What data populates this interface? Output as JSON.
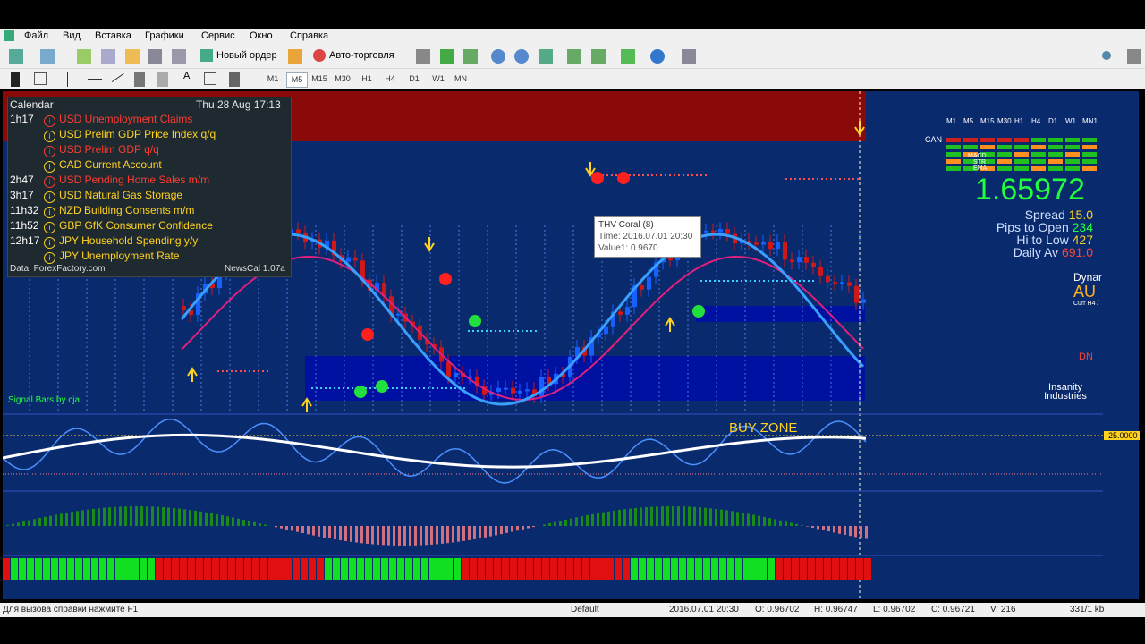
{
  "menu": [
    "Файл",
    "Вид",
    "Вставка",
    "Графики",
    "Сервис",
    "Окно",
    "Справка"
  ],
  "toolbar": {
    "new_order": "Новый ордер",
    "auto_trade": "Авто-торговля"
  },
  "timeframes": [
    "M1",
    "M5",
    "M15",
    "M30",
    "H1",
    "H4",
    "D1",
    "W1",
    "MN"
  ],
  "selected_tf": "M5",
  "calendar": {
    "title": "Calendar",
    "date": "Thu 28 Aug 17:13",
    "rows": [
      {
        "time": "1h17",
        "text": "USD Unemployment Claims",
        "color": "red"
      },
      {
        "time": "",
        "text": "USD Prelim GDP Price Index q/q",
        "color": "yel"
      },
      {
        "time": "",
        "text": "USD Prelim GDP q/q",
        "color": "red"
      },
      {
        "time": "",
        "text": "CAD Current Account",
        "color": "yel"
      },
      {
        "time": "2h47",
        "text": "USD Pending Home Sales m/m",
        "color": "red"
      },
      {
        "time": "3h17",
        "text": "USD Natural Gas Storage",
        "color": "yel"
      },
      {
        "time": "11h32",
        "text": "NZD Building Consents m/m",
        "color": "yel"
      },
      {
        "time": "11h52",
        "text": "GBP GfK Consumer Confidence",
        "color": "yel"
      },
      {
        "time": "12h17",
        "text": "JPY Household Spending y/y",
        "color": "yel"
      },
      {
        "time": "",
        "text": "JPY Unemployment Rate",
        "color": "yel"
      }
    ],
    "source": "Data: ForexFactory.com",
    "version": "NewsCal 1.07a"
  },
  "tooltip": {
    "name": "THV Coral (8)",
    "time": "Time: 2016.07.01 20:30",
    "value": "Value1: 0.9670"
  },
  "signal_label": "Signal Bars by cja",
  "buy_zone": "BUY ZONE",
  "osc_level": "-25.0000",
  "panel": {
    "tf_header": [
      "M1",
      "M5",
      "M15",
      "M30",
      "H1",
      "H4",
      "D1",
      "W1",
      "MN1"
    ],
    "can": "CAN",
    "rows": [
      "MACD",
      "STR",
      "EMA"
    ],
    "price": "1.65972",
    "spread_label": "Spread",
    "spread": "15.0",
    "pips_label": "Pips to Open",
    "pips": "234",
    "hilo_label": "Hi to Low",
    "hilo": "427",
    "daily_label": "Daily Av",
    "daily": "691.0",
    "dyn": "Dynar",
    "sym": "AU",
    "curr": "Curr H4 /",
    "dn": "DN",
    "brand": "Insanity Industries"
  },
  "status": {
    "help": "Для вызова справки нажмите F1",
    "profile": "Default",
    "datetime": "2016.07.01 20:30",
    "open": "O: 0.96702",
    "high": "H: 0.96747",
    "low": "L: 0.96702",
    "close": "C: 0.96721",
    "vol": "V: 216",
    "traffic": "331/1 kb"
  },
  "colors": {
    "bg": "#0a2a6e",
    "bull": "#1560ff",
    "bear": "#d01818",
    "accent": "#ffd21f"
  }
}
